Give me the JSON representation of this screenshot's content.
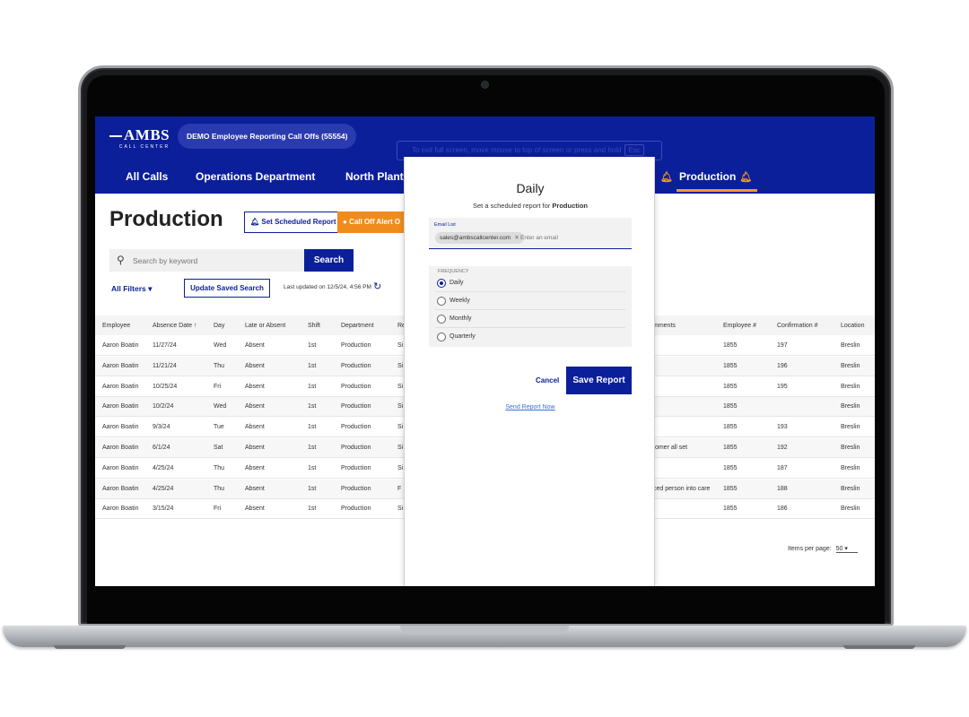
{
  "header": {
    "logo_text": "AMBS",
    "logo_subtext": "CALL CENTER",
    "account": "DEMO Employee Reporting Call Offs (55554)",
    "fullscreen_hint": "To exit full screen, move mouse to top of screen or press and hold",
    "fullscreen_key": "Esc",
    "tabs": [
      {
        "label": "All Calls"
      },
      {
        "label": "Operations Department"
      },
      {
        "label": "North Plant"
      },
      {
        "label": "Production",
        "active": true
      }
    ]
  },
  "page": {
    "title": "Production",
    "set_scheduled_report_label": "Set Scheduled Report",
    "call_off_alert_label": "Call Off Alert O",
    "search_placeholder": "Search by keyword",
    "search_button": "Search",
    "all_filters": "All Filters",
    "update_saved_search": "Update Saved Search",
    "last_updated": "Last updated on 12/5/24, 4:56 PM"
  },
  "table": {
    "columns": [
      "Employee",
      "Absence Date ↑",
      "Day",
      "Late or Absent",
      "Shift",
      "Department",
      "Re",
      "mments",
      "Employee #",
      "Confirmation #",
      "Location"
    ],
    "rows": [
      [
        "Aaron Boatin",
        "11/27/24",
        "Wed",
        "Absent",
        "1st",
        "Production",
        "Si",
        "",
        "1855",
        "197",
        "Breslin"
      ],
      [
        "Aaron Boatin",
        "11/21/24",
        "Thu",
        "Absent",
        "1st",
        "Production",
        "Si",
        "",
        "1855",
        "196",
        "Breslin"
      ],
      [
        "Aaron Boatin",
        "10/25/24",
        "Fri",
        "Absent",
        "1st",
        "Production",
        "Si",
        "",
        "1855",
        "195",
        "Breslin"
      ],
      [
        "Aaron Boatin",
        "10/2/24",
        "Wed",
        "Absent",
        "1st",
        "Production",
        "Si",
        "",
        "1855",
        "",
        "Breslin"
      ],
      [
        "Aaron Boatin",
        "9/3/24",
        "Tue",
        "Absent",
        "1st",
        "Production",
        "Si",
        "",
        "1855",
        "193",
        "Breslin"
      ],
      [
        "Aaron Boatin",
        "6/1/24",
        "Sat",
        "Absent",
        "1st",
        "Production",
        "Si",
        "tomer all set",
        "1855",
        "192",
        "Breslin"
      ],
      [
        "Aaron Boatin",
        "4/25/24",
        "Thu",
        "Absent",
        "1st",
        "Production",
        "Si",
        "",
        "1855",
        "187",
        "Breslin"
      ],
      [
        "Aaron Boatin",
        "4/25/24",
        "Thu",
        "Absent",
        "1st",
        "Production",
        "F",
        "ced person into care",
        "1855",
        "188",
        "Breslin"
      ],
      [
        "Aaron Boatin",
        "3/15/24",
        "Fri",
        "Absent",
        "1st",
        "Production",
        "Si",
        "",
        "1855",
        "186",
        "Breslin"
      ]
    ],
    "items_per_page_label": "Items per page:",
    "items_per_page_value": "50"
  },
  "modal": {
    "title": "Daily",
    "subtitle_prefix": "Set a scheduled report for",
    "subtitle_target": "Production",
    "email_list_label": "Email List",
    "email_chip": "sales@ambscallcenter.com",
    "email_placeholder": "Enter an email",
    "frequency_label": "FREQUENCY",
    "frequency_options": [
      {
        "label": "Daily",
        "selected": true
      },
      {
        "label": "Weekly",
        "selected": false
      },
      {
        "label": "Monthly",
        "selected": false
      },
      {
        "label": "Quarterly",
        "selected": false
      }
    ],
    "cancel_label": "Cancel",
    "save_label": "Save Report",
    "send_now_label": "Send Report Now"
  },
  "colors": {
    "brand_blue": "#0b1f9a",
    "accent_orange": "#f08c1c"
  }
}
